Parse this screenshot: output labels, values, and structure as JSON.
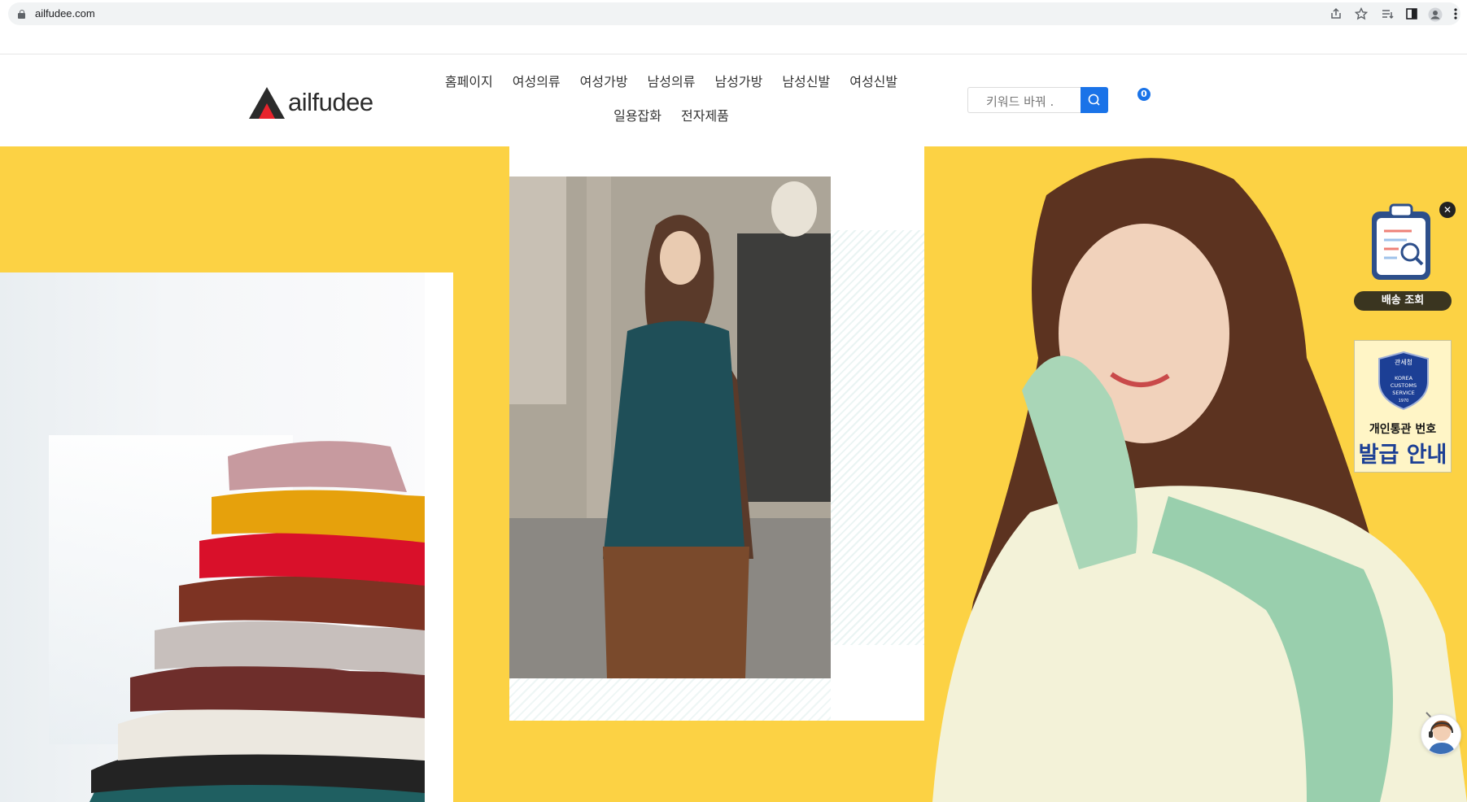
{
  "browser": {
    "url": "ailfudee.com"
  },
  "site": {
    "logo_text": "ailfudee",
    "nav_row1": [
      "홈페이지",
      "여성의류",
      "여성가방",
      "남성의류",
      "남성가방",
      "남성신발",
      "여성신발"
    ],
    "nav_row2": [
      "일용잡화",
      "전자제품"
    ],
    "search_placeholder": "키워드 바꿔 .",
    "cart_count": "0"
  },
  "widgets": {
    "delivery_label": "배송 조회",
    "close_symbol": "✕",
    "customs_line1": "개인통관 번호",
    "customs_line2": "발급 안내",
    "customs_seal_top": "관세청",
    "customs_seal_text": "KOREA CUSTOMS SERVICE",
    "customs_seal_year": "1970"
  },
  "colors": {
    "banner_yellow": "#fcd244",
    "accent_blue": "#1a73e8"
  }
}
